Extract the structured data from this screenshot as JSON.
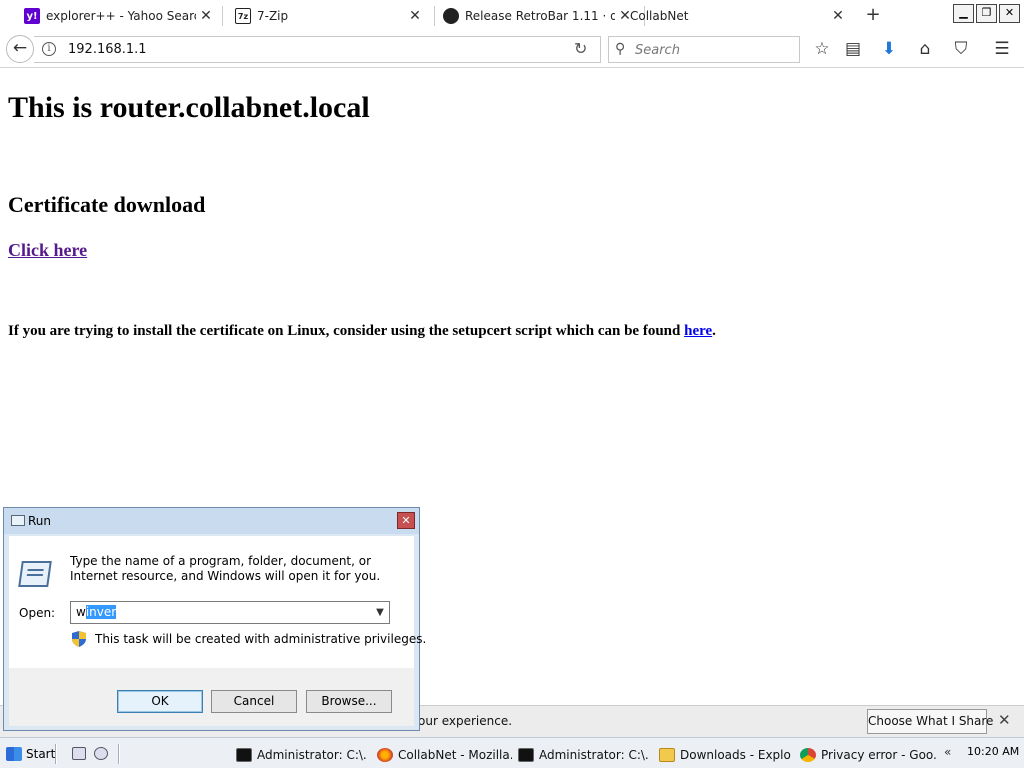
{
  "tabs": [
    {
      "title": "explorer++ - Yahoo Searc...",
      "icon": "yahoo-icon",
      "active": false
    },
    {
      "title": "7-Zip",
      "icon": "7zip-icon",
      "active": false
    },
    {
      "title": "Release RetroBar 1.11 · dre...",
      "icon": "github-icon",
      "active": false
    },
    {
      "title": "CollabNet",
      "icon": "",
      "active": true
    }
  ],
  "nav": {
    "url": "192.168.1.1",
    "search_placeholder": "Search"
  },
  "page": {
    "heading": "This is router.collabnet.local",
    "subheading": "Certificate download",
    "click_link": "Click here",
    "linux_text": "If you are trying to install the certificate on Linux, consider using the setupcert script which can be found ",
    "linux_link": "here",
    "linux_end": "."
  },
  "notification": {
    "text": "our experience.",
    "button": "Choose What I Share"
  },
  "run_dialog": {
    "title": "Run",
    "message": "Type the name of a program, folder, document, or Internet resource, and Windows will open it for you.",
    "open_label": "Open:",
    "open_value_prefix": "w",
    "open_value_selected": "inver",
    "admin_note": "This task will be created with administrative privileges.",
    "ok": "OK",
    "cancel": "Cancel",
    "browse": "Browse..."
  },
  "taskbar": {
    "start": "Start",
    "items": [
      {
        "label": "Administrator: C:\\...",
        "icon": "cmd-icon"
      },
      {
        "label": "CollabNet - Mozilla...",
        "icon": "firefox-icon"
      },
      {
        "label": "Administrator: C:\\...",
        "icon": "cmd-icon"
      },
      {
        "label": "Downloads - Explo...",
        "icon": "folder-icon"
      },
      {
        "label": "Privacy error - Goo...",
        "icon": "chrome-icon"
      }
    ],
    "tray_arrows": "«",
    "clock": "10:20 AM"
  },
  "colors": {
    "link_visited": "#551a8b",
    "link": "#0000ee",
    "selection": "#3399ff",
    "yahoo": "#6001d2",
    "dialog_title": "#c9dcef"
  }
}
